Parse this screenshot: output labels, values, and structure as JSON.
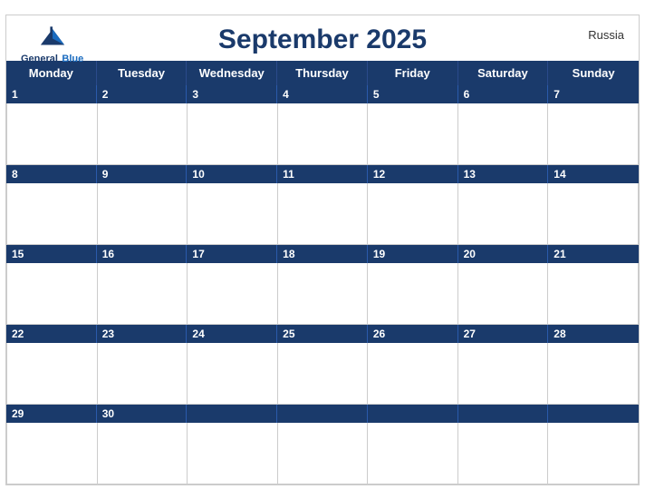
{
  "header": {
    "title": "September 2025",
    "country": "Russia",
    "logo": {
      "general": "General",
      "blue": "Blue"
    }
  },
  "days": [
    "Monday",
    "Tuesday",
    "Wednesday",
    "Thursday",
    "Friday",
    "Saturday",
    "Sunday"
  ],
  "weeks": [
    {
      "dates": [
        1,
        2,
        3,
        4,
        5,
        6,
        7
      ]
    },
    {
      "dates": [
        8,
        9,
        10,
        11,
        12,
        13,
        14
      ]
    },
    {
      "dates": [
        15,
        16,
        17,
        18,
        19,
        20,
        21
      ]
    },
    {
      "dates": [
        22,
        23,
        24,
        25,
        26,
        27,
        28
      ]
    },
    {
      "dates": [
        29,
        30,
        null,
        null,
        null,
        null,
        null
      ]
    }
  ],
  "colors": {
    "header_bg": "#1a3a6b",
    "header_text": "#ffffff",
    "cell_bg": "#ffffff",
    "border": "#cccccc"
  }
}
